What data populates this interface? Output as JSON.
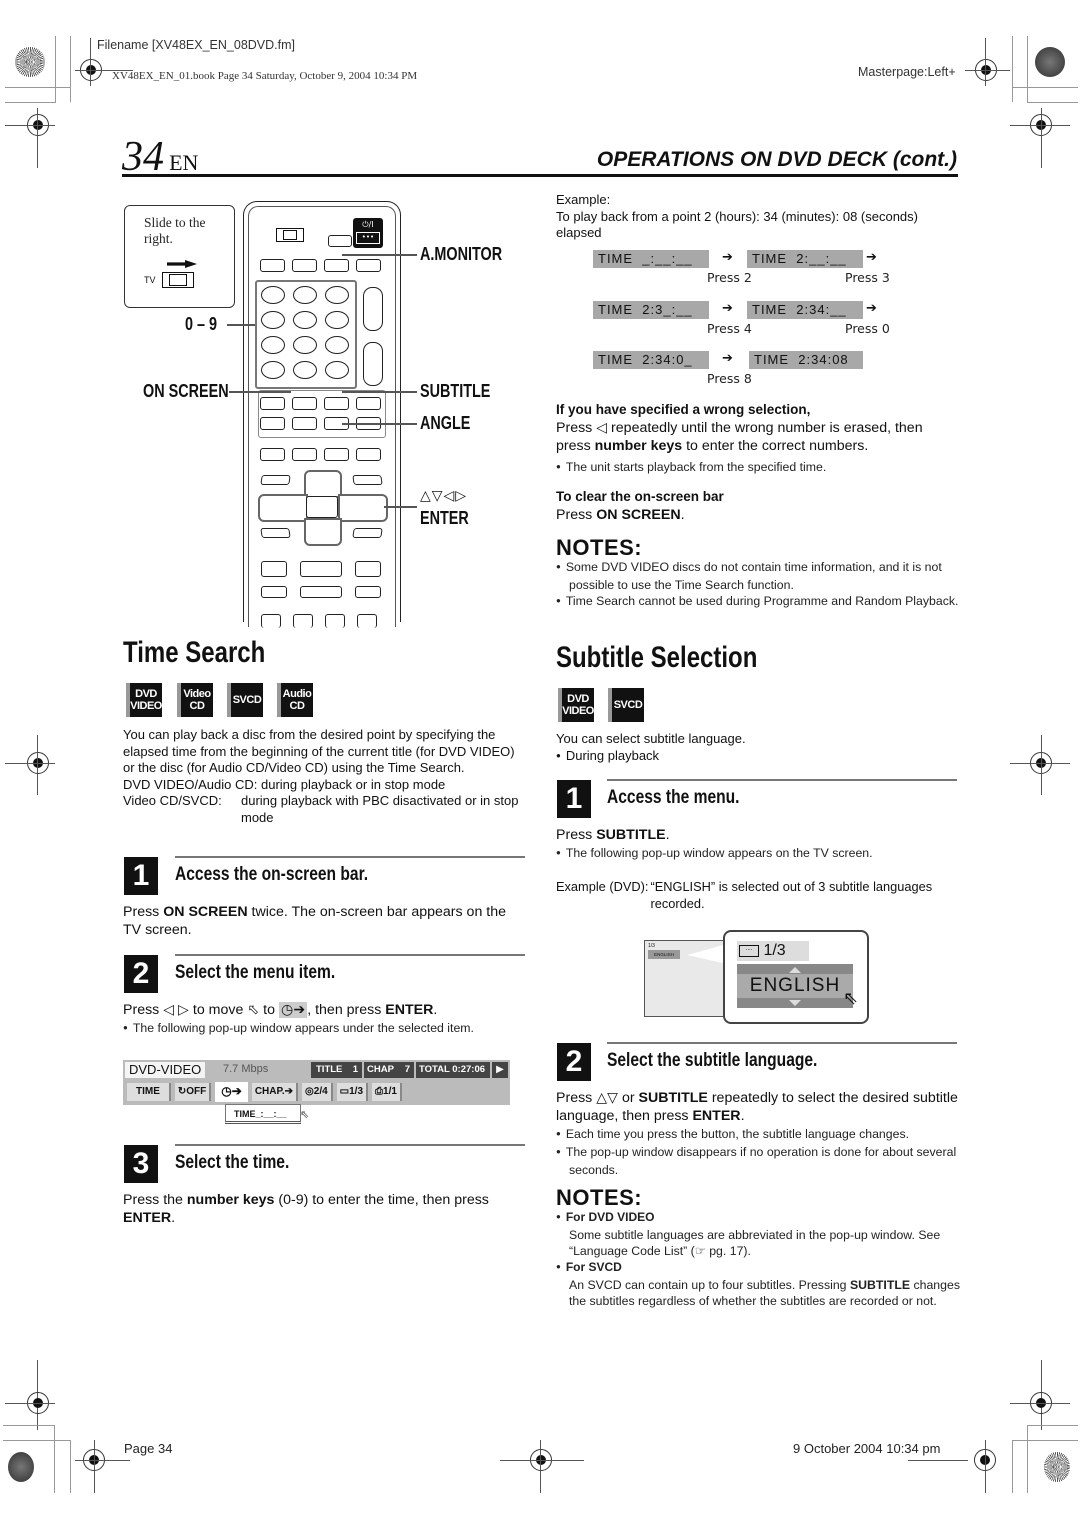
{
  "print_marks": {
    "filename": "Filename [XV48EX_EN_08DVD.fm]",
    "book_info": "XV48EX_EN_01.book  Page 34  Saturday, October 9, 2004  10:34 PM",
    "masterpage": "Masterpage:Left+",
    "footer_page": "Page 34",
    "footer_date": "9 October 2004 10:34 pm"
  },
  "header": {
    "page_number": "34",
    "page_lang": "EN",
    "section_title": "OPERATIONS ON DVD DECK (cont.)"
  },
  "remote": {
    "slide_note": [
      "Slide to the",
      "right."
    ],
    "tv_label": "TV",
    "power_label": "⏻/I",
    "callouts": {
      "a_monitor": "A.MONITOR",
      "zero_nine": "0 – 9",
      "on_screen": "ON SCREEN",
      "subtitle": "SUBTITLE",
      "angle": "ANGLE",
      "arrows": "△▽◁▷",
      "enter": "ENTER"
    }
  },
  "time_search": {
    "title": "Time Search",
    "badges": [
      {
        "line1": "DVD",
        "line2": "VIDEO"
      },
      {
        "line1": "Video",
        "line2": "CD"
      },
      {
        "line1": "SVCD",
        "line2": ""
      },
      {
        "line1": "Audio",
        "line2": "CD"
      }
    ],
    "intro": "You can play back a disc from the desired point by specifying the elapsed time from the beginning of the current title (for DVD VIDEO) or the disc (for Audio CD/Video CD) using the Time Search.",
    "mode1_label": "DVD VIDEO/Audio CD:",
    "mode1_text": "during playback or in stop mode",
    "mode2_label": "Video CD/SVCD:",
    "mode2_text": "during playback with PBC disactivated or in stop mode",
    "steps": [
      {
        "num": "1",
        "title": "Access the on-screen bar.",
        "text_pre": "Press ",
        "text_bold": "ON SCREEN",
        "text_post": " twice. The on-screen bar appears on the TV screen."
      },
      {
        "num": "2",
        "title": "Select the menu item.",
        "text_pre": "Press ◁ ▷ to move ⬁ to",
        "text_icon": "◷➔",
        "text_post": ", then press ",
        "text_bold": "ENTER",
        "text_end": ".",
        "bullet": "The following pop-up window appears under the selected item."
      },
      {
        "num": "3",
        "title": "Select the time.",
        "text_pre": "Press the ",
        "text_bold": "number keys",
        "text_post": " (0-9) to enter the time, then press ",
        "text_bold2": "ENTER",
        "text_end": "."
      }
    ],
    "onscreen_bar": {
      "disc_type": "DVD-VIDEO",
      "bitrate": "7.7 Mbps",
      "title_label": "TITLE",
      "title_value": "1",
      "chap_label": "CHAP",
      "chap_value": "7",
      "total_label": "TOTAL",
      "total_value": "0:27:06",
      "play_icon": "▶",
      "items": [
        {
          "icon": "",
          "label": "TIME"
        },
        {
          "icon": "↻",
          "label": "OFF"
        },
        {
          "icon": "◷",
          "label": "➔"
        },
        {
          "icon": "",
          "label": "CHAP.➔"
        },
        {
          "icon": "◎",
          "label": "2/4"
        },
        {
          "icon": "▭",
          "label": "1/3"
        },
        {
          "icon": "⎙",
          "label": "1/1"
        }
      ],
      "popup_value": "TIME_:__:__"
    }
  },
  "example": {
    "label": "Example:",
    "desc": "To play back from a point 2 (hours): 34 (minutes): 08 (seconds) elapsed",
    "rows": [
      {
        "left": "TIME  _:__:__",
        "right": "TIME  2:__:__",
        "press_left": "Press 2",
        "press_right": "Press 3",
        "trailing_arrow": true
      },
      {
        "left": "TIME  2:3_:__",
        "right": "TIME  2:34:__",
        "press_left": "Press 4",
        "press_right": "Press 0",
        "trailing_arrow": true
      },
      {
        "left": "TIME  2:34:0_",
        "right": "TIME  2:34:08",
        "press_left": "Press 8",
        "press_right": "",
        "trailing_arrow": false
      }
    ],
    "arrow": "➔"
  },
  "wrong_selection": {
    "heading": "If you have specified a wrong selection,",
    "text_pre": "Press ◁ repeatedly until the wrong number is erased, then press ",
    "text_bold": "number keys",
    "text_post": " to enter the correct numbers.",
    "bullet": "The unit starts playback from the specified time."
  },
  "clear_bar": {
    "heading": "To clear the on-screen bar",
    "text_pre": "Press ",
    "text_bold": "ON SCREEN",
    "text_post": "."
  },
  "notes1": {
    "heading": "NOTES:",
    "items": [
      "Some DVD VIDEO discs do not contain time information, and it is not possible to use the Time Search function.",
      "Time Search cannot be used during Programme and Random Playback."
    ]
  },
  "subtitle_selection": {
    "title": "Subtitle Selection",
    "badges": [
      {
        "line1": "DVD",
        "line2": "VIDEO"
      },
      {
        "line1": "SVCD",
        "line2": ""
      }
    ],
    "intro": "You can select subtitle language.",
    "intro_bullet": "During playback",
    "steps": [
      {
        "num": "1",
        "title": "Access the menu.",
        "text_pre": "Press ",
        "text_bold": "SUBTITLE",
        "text_post": ".",
        "bullet": "The following pop-up window appears on the TV screen."
      },
      {
        "num": "2",
        "title": "Select the subtitle language.",
        "text_pre": "Press △▽ or ",
        "text_bold": "SUBTITLE",
        "text_post": " repeatedly to select the desired subtitle language, then press ",
        "text_bold2": "ENTER",
        "text_end": ".",
        "bullets": [
          "Each time you press the button, the subtitle language changes.",
          "The pop-up window disappears if no operation is done for about several seconds."
        ]
      }
    ],
    "example_label": "Example (DVD):",
    "example_text": "“ENGLISH” is selected out of 3 subtitle languages recorded.",
    "popup": {
      "count": "1/3",
      "language": "ENGLISH",
      "mini_count": "1/3",
      "mini_language": "ENGLISH"
    }
  },
  "notes2": {
    "heading": "NOTES:",
    "items": [
      {
        "title": "For DVD VIDEO",
        "text": "Some subtitle languages are abbreviated in the pop-up window. See “Language Code List” (☞ pg. 17)."
      },
      {
        "title": "For SVCD",
        "text_pre": "An SVCD can contain up to four subtitles. Pressing ",
        "text_bold": "SUBTITLE",
        "text_post": " changes the subtitles regardless of whether the subtitles are recorded or not."
      }
    ]
  }
}
